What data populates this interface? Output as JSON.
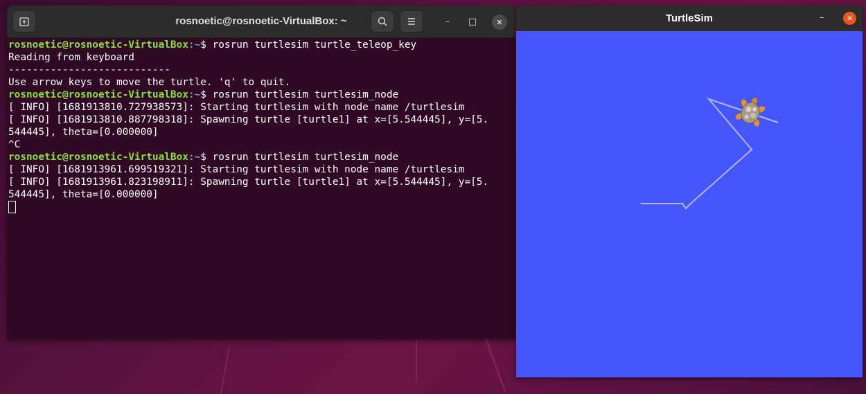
{
  "terminal": {
    "title": "rosnoetic@rosnoetic-VirtualBox: ~",
    "new_tab_icon": "new-tab-icon",
    "search_icon": "search-icon",
    "menu_icon": "hamburger-menu-icon",
    "minimize": "–",
    "maximize": "□",
    "close": "✕",
    "lines": [
      {
        "type": "prompt",
        "user": "rosnoetic@rosnoetic-VirtualBox",
        "path": ":~",
        "cmd": "$ rosrun turtlesim turtle_teleop_key"
      },
      {
        "type": "text",
        "text": "Reading from keyboard"
      },
      {
        "type": "text",
        "text": "---------------------------"
      },
      {
        "type": "text",
        "text": "Use arrow keys to move the turtle. 'q' to quit."
      },
      {
        "type": "prompt",
        "user": "rosnoetic@rosnoetic-VirtualBox",
        "path": ":~",
        "cmd": "$ rosrun turtlesim turtlesim_node"
      },
      {
        "type": "text",
        "text": "[ INFO] [1681913810.727938573]: Starting turtlesim with node name /turtlesim"
      },
      {
        "type": "text",
        "text": "[ INFO] [1681913810.887798318]: Spawning turtle [turtle1] at x=[5.544445], y=[5."
      },
      {
        "type": "text",
        "text": "544445], theta=[0.000000]"
      },
      {
        "type": "text",
        "text": "^C"
      },
      {
        "type": "prompt",
        "user": "rosnoetic@rosnoetic-VirtualBox",
        "path": ":~",
        "cmd": "$ rosrun turtlesim turtlesim_node"
      },
      {
        "type": "text",
        "text": "[ INFO] [1681913961.699519321]: Starting turtlesim with node name /turtlesim"
      },
      {
        "type": "text",
        "text": "[ INFO] [1681913961.823198911]: Spawning turtle [turtle1] at x=[5.544445], y=[5."
      },
      {
        "type": "text",
        "text": "544445], theta=[0.000000]"
      },
      {
        "type": "cursor"
      }
    ]
  },
  "turtlesim": {
    "title": "TurtleSim",
    "minimize": "–",
    "close": "✕",
    "background_color": "#4556ff",
    "pen_color": "#b3b8ff",
    "turtle_icon": "turtle-icon"
  }
}
